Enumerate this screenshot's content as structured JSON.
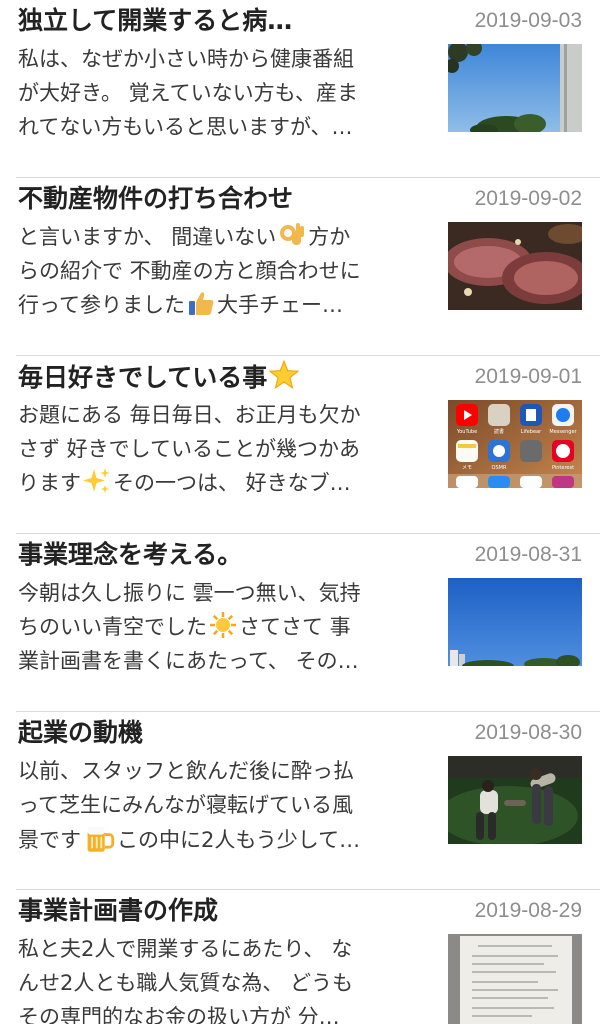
{
  "posts": [
    {
      "title": "独立して開業すると病…",
      "date": "2019-09-03",
      "line1": "私は、なぜか小さい時から健康番組",
      "line2": "が大好き。 覚えていない方も、産ま",
      "line3": "れてない方もいると思いますが、…",
      "thumbnail": "blue-sky-with-tree-photo"
    },
    {
      "title": "不動産物件の打ち合わせ",
      "date": "2019-09-02",
      "line1a": "と言いますか、 間違いない",
      "line1b": "方か",
      "line2": "らの紹介で 不動産の方と顔合わせに",
      "line3a": "行って参りました",
      "line3b": "大手チェー…",
      "thumbnail": "roast-beef-photo"
    },
    {
      "title": "毎日好きでしている事",
      "date": "2019-09-01",
      "line1": "お題にある 毎日毎日、お正月も欠か",
      "line2": "さず 好きでしていることが幾つかあ",
      "line3a": "ります",
      "line3b": "その一つは、 好きなブ…",
      "thumbnail": "phone-home-screen-photo",
      "app_labels": [
        "YouTube",
        "読書",
        "Lifebear",
        "Messenger",
        "メモ",
        "OSMR",
        "",
        "Pinterest"
      ]
    },
    {
      "title": "事業理念を考える。",
      "date": "2019-08-31",
      "line1": "今朝は久し振りに 雲一つ無い、気持",
      "line2a": "ちのいい青空でした",
      "line2b": "さてさて 事",
      "line3": "業計画書を書くにあたって、 その…",
      "thumbnail": "clear-blue-sky-photo"
    },
    {
      "title": "起業の動機",
      "date": "2019-08-30",
      "line1": "以前、スタッフと飲んだ後に酔っ払",
      "line2": "って芝生にみんなが寝転げている風",
      "line3a": "景です",
      "line3b": "この中に2人もう少して…",
      "thumbnail": "people-lying-on-grass-photo"
    },
    {
      "title": "事業計画書の作成",
      "date": "2019-08-29",
      "line1": "私と夫2人で開業するにあたり、 な",
      "line2": "んせ2人とも職人気質な為、 どうも",
      "line3": "その専門的なお金の扱い方が 分…",
      "thumbnail": "printed-document-photo"
    }
  ]
}
